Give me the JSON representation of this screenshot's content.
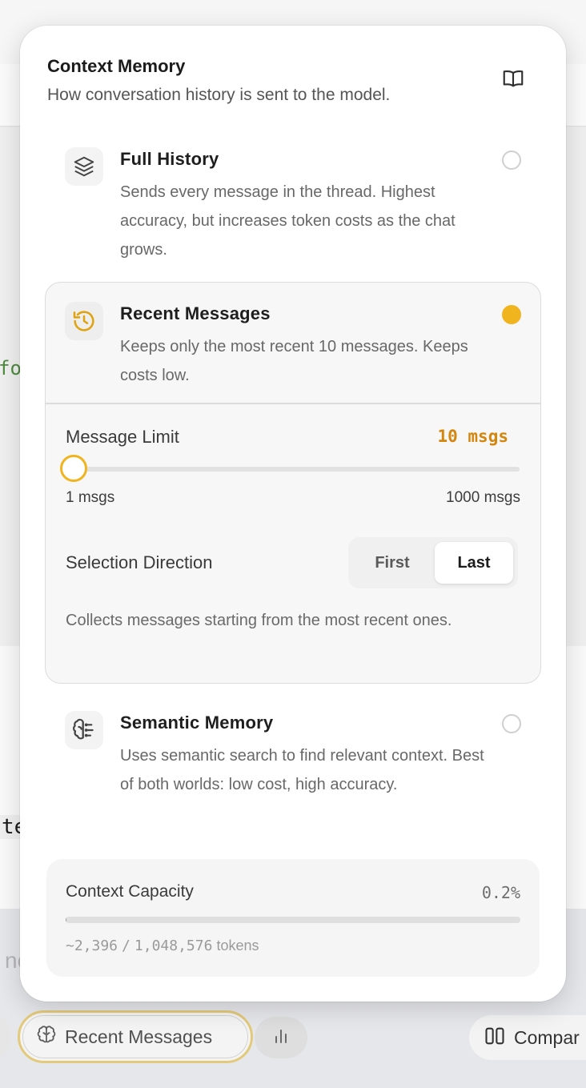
{
  "background": {
    "code_fragment_1": "fo",
    "code_fragment_2": "te",
    "input_placeholder_fragment": "ne",
    "toolbar": {
      "memory_button_label": "Recent Messages",
      "compare_button_label": "Compar"
    }
  },
  "popover": {
    "title": "Context Memory",
    "subtitle": "How conversation history is sent to the model.",
    "options": [
      {
        "id": "full",
        "title": "Full History",
        "description": "Sends every message in the thread. Highest accuracy, but increases token costs as the chat grows.",
        "selected": false,
        "icon": "layers-icon"
      },
      {
        "id": "recent",
        "title": "Recent Messages",
        "description": "Keeps only the most recent 10 messages. Keeps costs low.",
        "selected": true,
        "icon": "history-icon"
      },
      {
        "id": "semantic",
        "title": "Semantic Memory",
        "description": "Uses semantic search to find relevant context. Best of both worlds: low cost, high accuracy.",
        "selected": false,
        "icon": "brain-icon"
      }
    ],
    "recent_settings": {
      "limit_label": "Message Limit",
      "limit_value_text": "10 msgs",
      "slider": {
        "min": 1,
        "max": 1000,
        "value": 10,
        "min_label": "1 msgs",
        "max_label": "1000 msgs"
      },
      "direction_label": "Selection Direction",
      "direction_options": [
        "First",
        "Last"
      ],
      "direction_selected": "Last",
      "direction_help": "Collects messages starting from the most recent ones."
    },
    "capacity": {
      "label": "Context Capacity",
      "percent_text": "0.2%",
      "fraction": 0.0023,
      "tokens_used": "~2,396",
      "separator": "/",
      "tokens_total": "1,048,576",
      "tokens_suffix": "tokens"
    }
  },
  "colors": {
    "accent": "#f0b41e",
    "accent_text": "#d4860e",
    "radio_unselected": "#cfcfcf"
  }
}
